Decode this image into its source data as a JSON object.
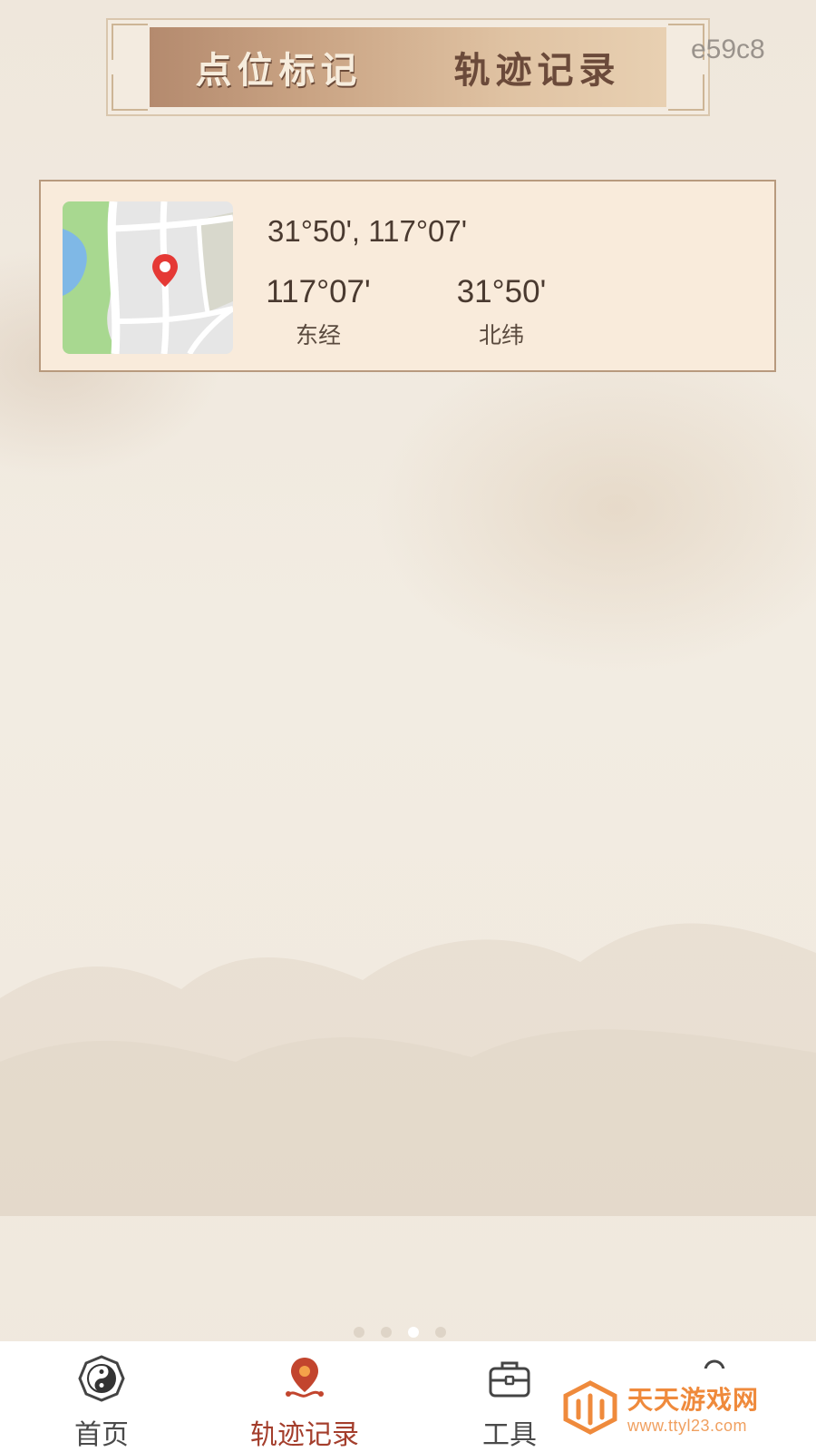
{
  "header": {
    "tabs": [
      {
        "label": "点位标记",
        "active": true
      },
      {
        "label": "轨迹记录",
        "active": false
      }
    ],
    "corner_code": "e59c8"
  },
  "record": {
    "coords_text": "31°50', 117°07'",
    "longitude": {
      "value": "117°07'",
      "label": "东经"
    },
    "latitude": {
      "value": "31°50'",
      "label": "北纬"
    },
    "map_icon": "map-pin-icon"
  },
  "pager": {
    "count": 4,
    "active_index": 2
  },
  "bottom_nav": {
    "items": [
      {
        "label": "首页",
        "icon": "yin-yang-icon",
        "active": false
      },
      {
        "label": "轨迹记录",
        "icon": "route-pin-icon",
        "active": true
      },
      {
        "label": "工具",
        "icon": "toolbox-icon",
        "active": false
      },
      {
        "label": "",
        "icon": "user-icon",
        "active": false
      }
    ]
  },
  "watermark": {
    "title": "天天游戏网",
    "url": "www.ttyl23.com"
  },
  "colors": {
    "accent": "#a43e2c",
    "card_background": "#f9ebdb",
    "card_border": "#b89a7e",
    "watermark_orange": "#ef8a3c"
  }
}
